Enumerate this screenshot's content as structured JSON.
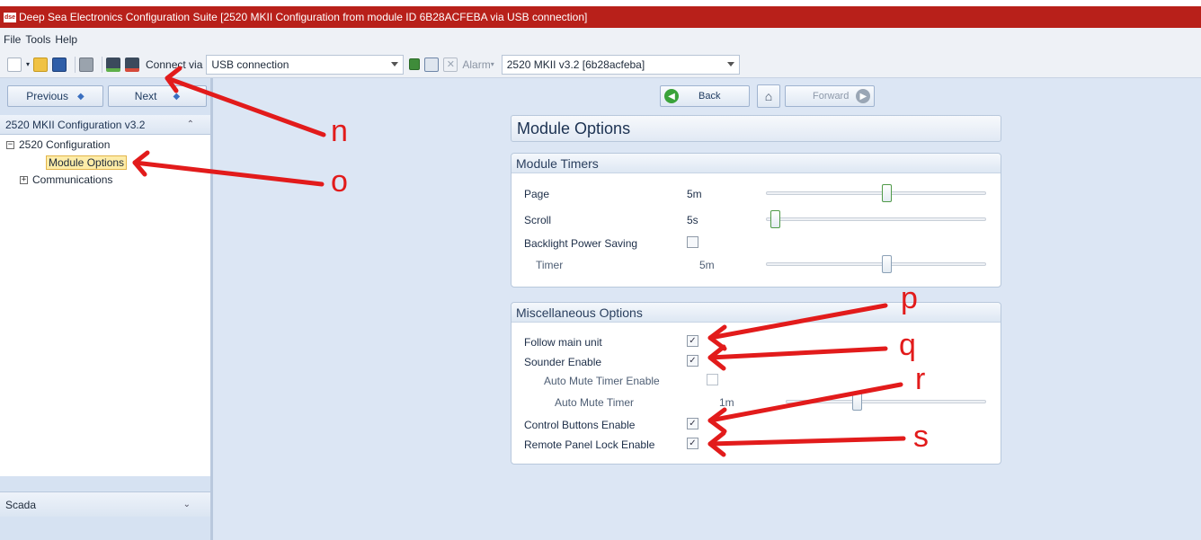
{
  "window": {
    "app_icon": "dse",
    "title": "Deep Sea Electronics Configuration Suite [2520 MKII Configuration from module ID 6B28ACFEBA via USB connection]"
  },
  "menu": {
    "file": "File",
    "tools": "Tools",
    "help": "Help"
  },
  "toolbar": {
    "connect_via_label": "Connect via",
    "connection_value": "USB connection",
    "alarm_label": "Alarm",
    "module_value": "2520 MKII v3.2 [6b28acfeba]"
  },
  "nav": {
    "previous": "Previous",
    "next": "Next",
    "back": "Back",
    "forward": "Forward"
  },
  "tree": {
    "header": "2520 MKII Configuration v3.2",
    "root": "2520 Configuration",
    "selected": "Module Options",
    "communications": "Communications"
  },
  "scada": {
    "label": "Scada"
  },
  "page": {
    "title": "Module Options",
    "timers": {
      "heading": "Module Timers",
      "page_label": "Page",
      "page_value": "5m",
      "page_level": 0.55,
      "scroll_label": "Scroll",
      "scroll_value": "5s",
      "scroll_level": 0.02,
      "backlight_label": "Backlight Power Saving",
      "backlight_checked": false,
      "timer_label": "Timer",
      "timer_value": "5m",
      "timer_level": 0.55
    },
    "misc": {
      "heading": "Miscellaneous Options",
      "follow_main_label": "Follow main unit",
      "follow_main_checked": true,
      "sounder_label": "Sounder Enable",
      "sounder_checked": true,
      "auto_mute_enable_label": "Auto Mute Timer Enable",
      "auto_mute_enable_checked": false,
      "auto_mute_timer_label": "Auto Mute Timer",
      "auto_mute_timer_value": "1m",
      "auto_mute_timer_level": 0.35,
      "control_buttons_label": "Control Buttons Enable",
      "control_buttons_checked": true,
      "remote_lock_label": "Remote Panel Lock Enable",
      "remote_lock_checked": true
    }
  },
  "annotations": {
    "n": "n",
    "o": "o",
    "p": "p",
    "q": "q",
    "r": "r",
    "s": "s"
  },
  "colors": {
    "titlebar": "#b8201a",
    "annotation": "#e21b1b"
  }
}
